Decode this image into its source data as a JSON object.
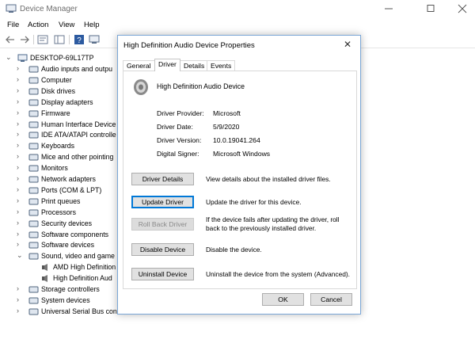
{
  "app": {
    "title": "Device Manager",
    "menu": [
      "File",
      "Action",
      "View",
      "Help"
    ]
  },
  "tree": {
    "root": "DESKTOP-69L17TP",
    "items": [
      {
        "label": "Audio inputs and outpu",
        "expanded": false
      },
      {
        "label": "Computer",
        "expanded": false
      },
      {
        "label": "Disk drives",
        "expanded": false
      },
      {
        "label": "Display adapters",
        "expanded": false
      },
      {
        "label": "Firmware",
        "expanded": false
      },
      {
        "label": "Human Interface Device",
        "expanded": false
      },
      {
        "label": "IDE ATA/ATAPI controlle",
        "expanded": false
      },
      {
        "label": "Keyboards",
        "expanded": false
      },
      {
        "label": "Mice and other pointing",
        "expanded": false
      },
      {
        "label": "Monitors",
        "expanded": false
      },
      {
        "label": "Network adapters",
        "expanded": false
      },
      {
        "label": "Ports (COM & LPT)",
        "expanded": false
      },
      {
        "label": "Print queues",
        "expanded": false
      },
      {
        "label": "Processors",
        "expanded": false
      },
      {
        "label": "Security devices",
        "expanded": false
      },
      {
        "label": "Software components",
        "expanded": false
      },
      {
        "label": "Software devices",
        "expanded": false
      },
      {
        "label": "Sound, video and game",
        "expanded": true
      },
      {
        "label": "AMD High Definition",
        "child": true
      },
      {
        "label": "High Definition Aud",
        "child": true
      },
      {
        "label": "Storage controllers",
        "expanded": false
      },
      {
        "label": "System devices",
        "expanded": false
      },
      {
        "label": "Universal Serial Bus cont",
        "expanded": false
      }
    ]
  },
  "dialog": {
    "title": "High Definition Audio Device Properties",
    "close": "✕",
    "tabs": [
      "General",
      "Driver",
      "Details",
      "Events"
    ],
    "active_tab": "Driver",
    "device_name": "High Definition Audio Device",
    "props": [
      {
        "label": "Driver Provider:",
        "value": "Microsoft"
      },
      {
        "label": "Driver Date:",
        "value": "5/9/2020"
      },
      {
        "label": "Driver Version:",
        "value": "10.0.19041.264"
      },
      {
        "label": "Digital Signer:",
        "value": "Microsoft Windows"
      }
    ],
    "actions": [
      {
        "label": "Driver Details",
        "desc": "View details about the installed driver files."
      },
      {
        "label": "Update Driver",
        "desc": "Update the driver for this device."
      },
      {
        "label": "Roll Back Driver",
        "desc": "If the device fails after updating the driver, roll back to the previously installed driver."
      },
      {
        "label": "Disable Device",
        "desc": "Disable the device."
      },
      {
        "label": "Uninstall Device",
        "desc": "Uninstall the device from the system (Advanced)."
      }
    ],
    "ok": "OK",
    "cancel": "Cancel"
  },
  "colors": {
    "accent": "#0078d7",
    "dialog_border": "#7aa6d6"
  }
}
